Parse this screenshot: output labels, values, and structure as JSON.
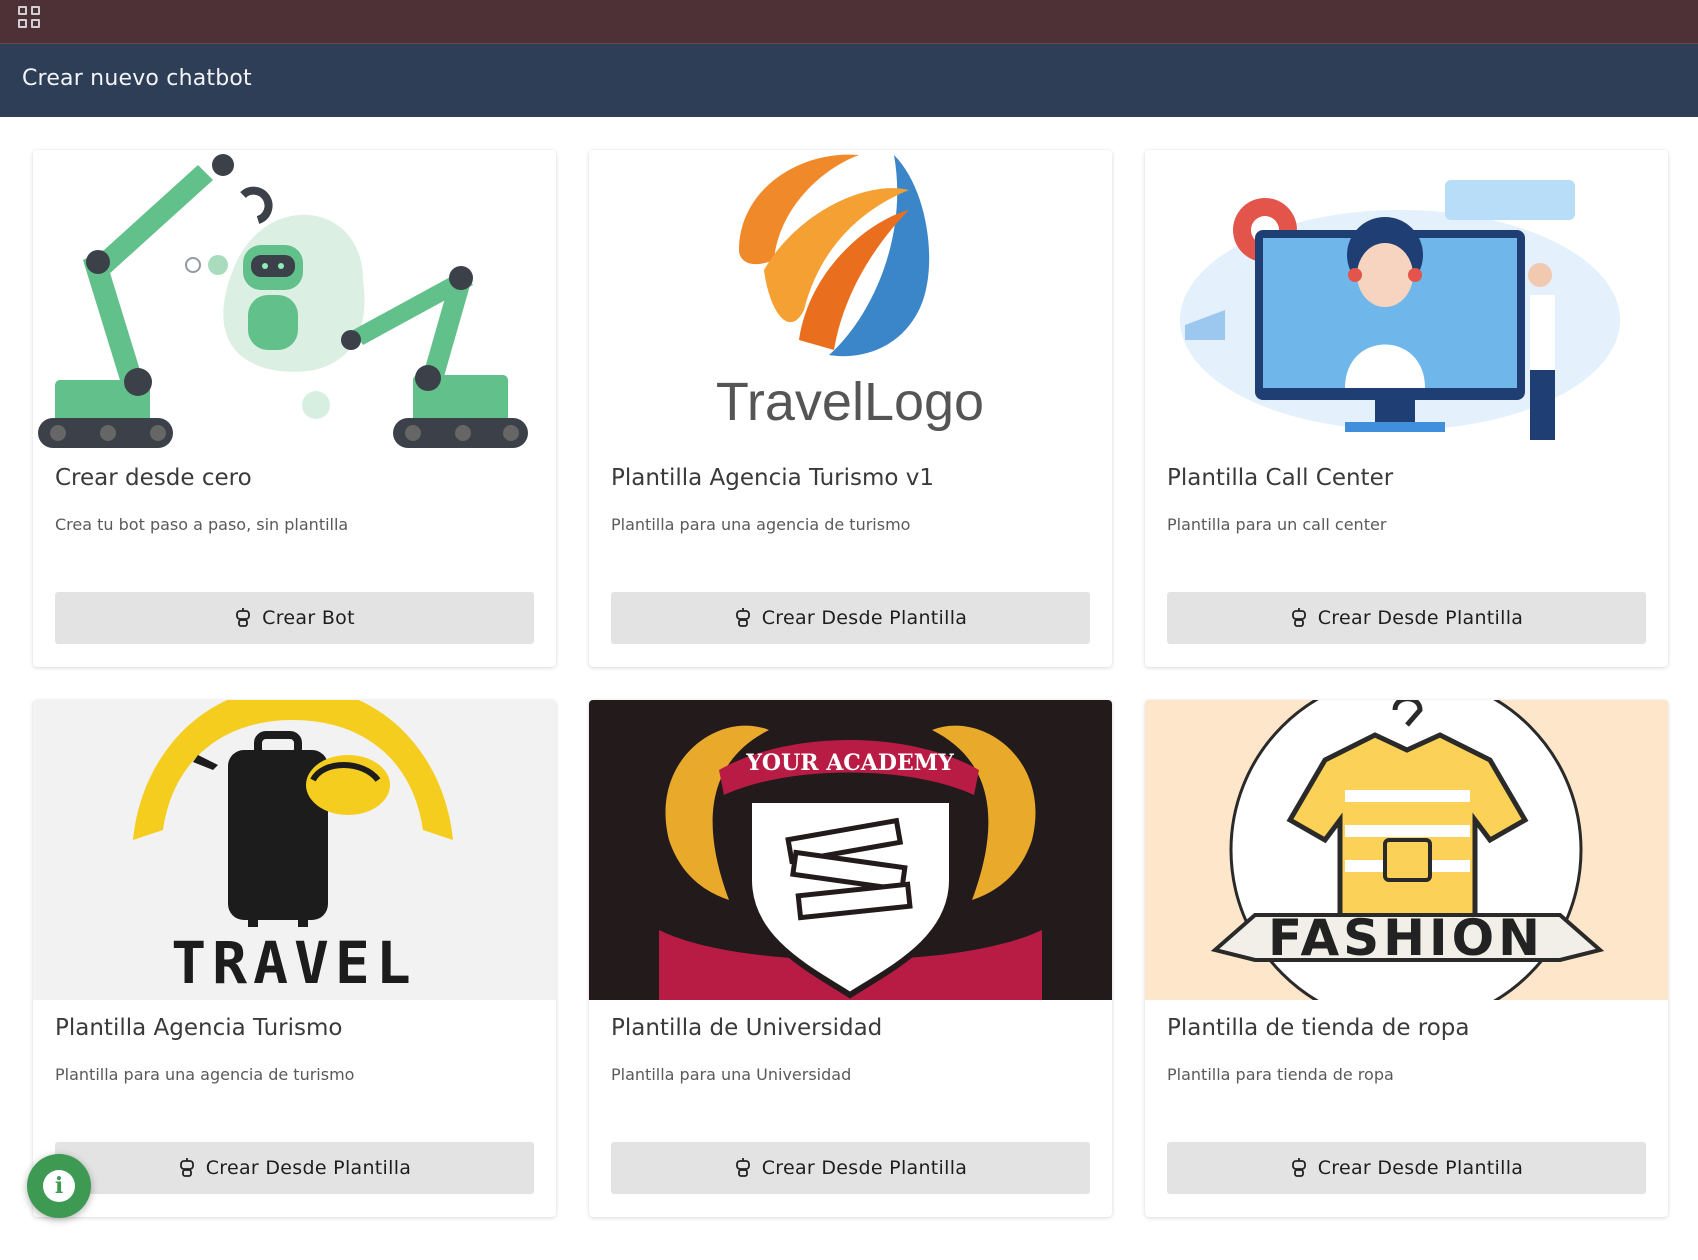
{
  "header": {
    "title": "Crear nuevo chatbot"
  },
  "cards": [
    {
      "title": "Crear desde cero",
      "description": "Crea tu bot paso a paso, sin plantilla",
      "button": "Crear Bot",
      "image": "robot-arms-illustration"
    },
    {
      "title": "Plantilla Agencia Turismo v1",
      "description": "Plantilla para una agencia de turismo",
      "button": "Crear Desde Plantilla",
      "image": "travel-logo",
      "image_text": "TravelLogo"
    },
    {
      "title": "Plantilla Call Center",
      "description": "Plantilla para un call center",
      "button": "Crear Desde Plantilla",
      "image": "call-center-illustration"
    },
    {
      "title": "Plantilla Agencia Turismo",
      "description": "Plantilla para una agencia de turismo",
      "button": "Crear Desde Plantilla",
      "image": "travel-suitcase-logo",
      "image_text": "TRAVEL"
    },
    {
      "title": "Plantilla de Universidad",
      "description": "Plantilla para una Universidad",
      "button": "Crear Desde Plantilla",
      "image": "academy-crest-logo",
      "image_text": "YOUR ACADEMY"
    },
    {
      "title": "Plantilla de tienda de ropa",
      "description": "Plantilla para tienda de ropa",
      "button": "Crear Desde Plantilla",
      "image": "fashion-shirt-logo",
      "image_text": "FASHION"
    }
  ],
  "icons": {
    "apps": "grid-apps-icon",
    "button": "robot-icon",
    "fab": "info-icon"
  },
  "colors": {
    "topbar": "#4e3136",
    "header": "#2e3e57",
    "button_bg": "#e3e3e3",
    "fab": "#3e9a52"
  }
}
